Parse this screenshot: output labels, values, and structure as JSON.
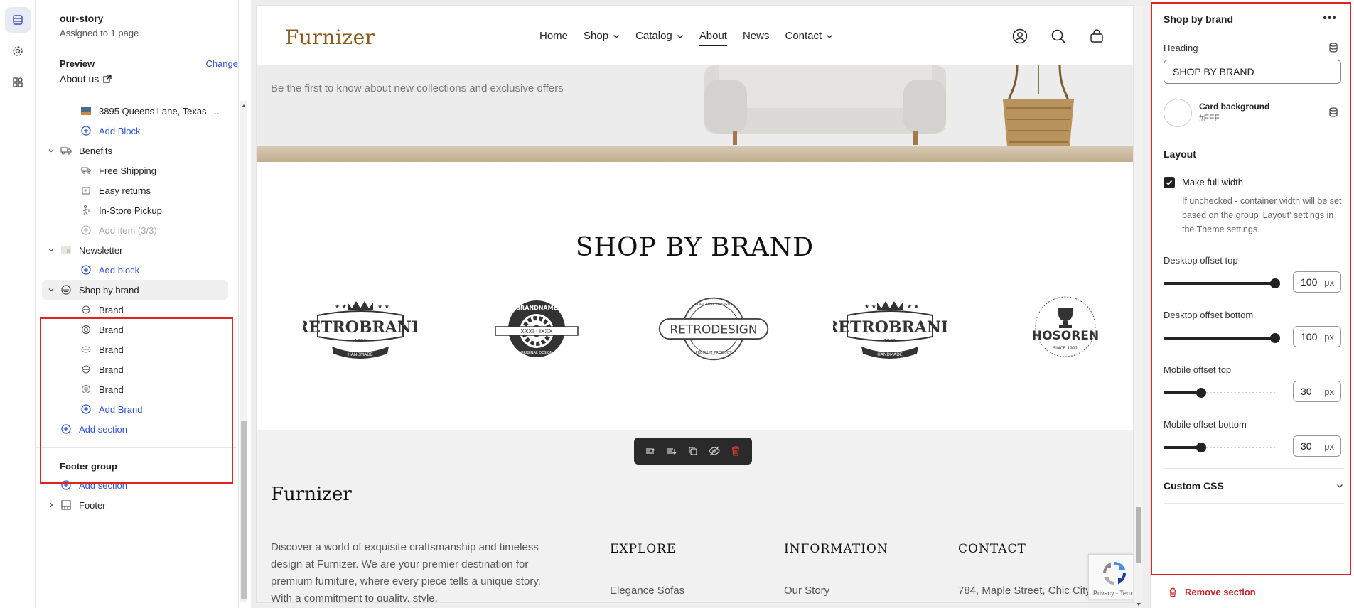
{
  "rail": {
    "icons": [
      "sections-icon",
      "settings-icon",
      "apps-icon"
    ]
  },
  "sidebar": {
    "page_name": "our-story",
    "page_assigned": "Assigned to 1 page",
    "preview_label": "Preview",
    "preview_change": "Change",
    "preview_page": "About us",
    "tree": {
      "address": "3895 Queens Lane, Texas, ...",
      "add_block_1": "Add Block",
      "benefits": "Benefits",
      "free_shipping": "Free Shipping",
      "easy_returns": "Easy returns",
      "pickup": "In-Store Pickup",
      "add_item": "Add item (3/3)",
      "newsletter": "Newsletter",
      "add_block_2": "Add block",
      "shop_by_brand": "Shop by brand",
      "brands": [
        "Brand",
        "Brand",
        "Brand",
        "Brand",
        "Brand"
      ],
      "add_brand": "Add Brand",
      "add_section": "Add section",
      "footer_group": "Footer group",
      "add_section_2": "Add section",
      "footer": "Footer"
    }
  },
  "site": {
    "logo": "Furnizer",
    "nav": [
      {
        "label": "Home",
        "dropdown": false,
        "current": false
      },
      {
        "label": "Shop",
        "dropdown": true,
        "current": false
      },
      {
        "label": "Catalog",
        "dropdown": true,
        "current": false
      },
      {
        "label": "About",
        "dropdown": false,
        "current": true
      },
      {
        "label": "News",
        "dropdown": false,
        "current": false
      },
      {
        "label": "Contact",
        "dropdown": true,
        "current": false
      }
    ],
    "hero_text": "Be the first to know about new collections and exclusive offers",
    "brand_title": "SHOP BY BRAND",
    "brands": [
      {
        "top": "★ ★",
        "name": "RETROBRAND",
        "year": "1991",
        "sub": "HANDMADE"
      },
      {
        "top": "BRANDNAME",
        "name": "",
        "year": "XXXI · IXXX",
        "sub": "ORIGINAL DESIGN"
      },
      {
        "top": "ORIGINAL DESIGN",
        "name": "RETRODESIGN",
        "year": "",
        "sub": "PREMIUM PRODUCT"
      },
      {
        "top": "★ ★",
        "name": "RETROBRAND",
        "year": "1991",
        "sub": "HANDMADE"
      },
      {
        "top": "",
        "name": "HOSOREN",
        "year": "",
        "sub": "SINCE 1991"
      }
    ],
    "footer": {
      "logo": "Furnizer",
      "desc": "Discover a world of exquisite craftsmanship and timeless design at Furnizer. We are your premier destination for premium furniture, where every piece tells a unique story. With a commitment to quality, style,",
      "cols": [
        {
          "title": "EXPLORE",
          "link": "Elegance Sofas"
        },
        {
          "title": "INFORMATION",
          "link": "Our Story"
        },
        {
          "title": "CONTACT",
          "link": "784, Maple Street, Chic City,"
        }
      ],
      "recaptcha": "Privacy - Terms"
    }
  },
  "panel": {
    "title": "Shop by brand",
    "heading_label": "Heading",
    "heading_value": "SHOP BY BRAND",
    "card_bg_label": "Card background",
    "card_bg_value": "#FFF",
    "layout_heading": "Layout",
    "full_width_label": "Make full width",
    "full_width_checked": true,
    "full_width_help": "If unchecked - container width will be set based on the group 'Layout' settings in the Theme settings.",
    "desktop_top_label": "Desktop offset top",
    "desktop_top_value": "100",
    "desktop_bottom_label": "Desktop offset bottom",
    "desktop_bottom_value": "100",
    "mobile_top_label": "Mobile offset top",
    "mobile_top_value": "30",
    "mobile_bottom_label": "Mobile offset bottom",
    "mobile_bottom_value": "30",
    "unit": "px",
    "custom_css": "Custom CSS",
    "remove_section": "Remove section"
  },
  "colors": {
    "accent": "#2f55d4",
    "danger": "#e02424",
    "logo": "#8a5a1c"
  }
}
